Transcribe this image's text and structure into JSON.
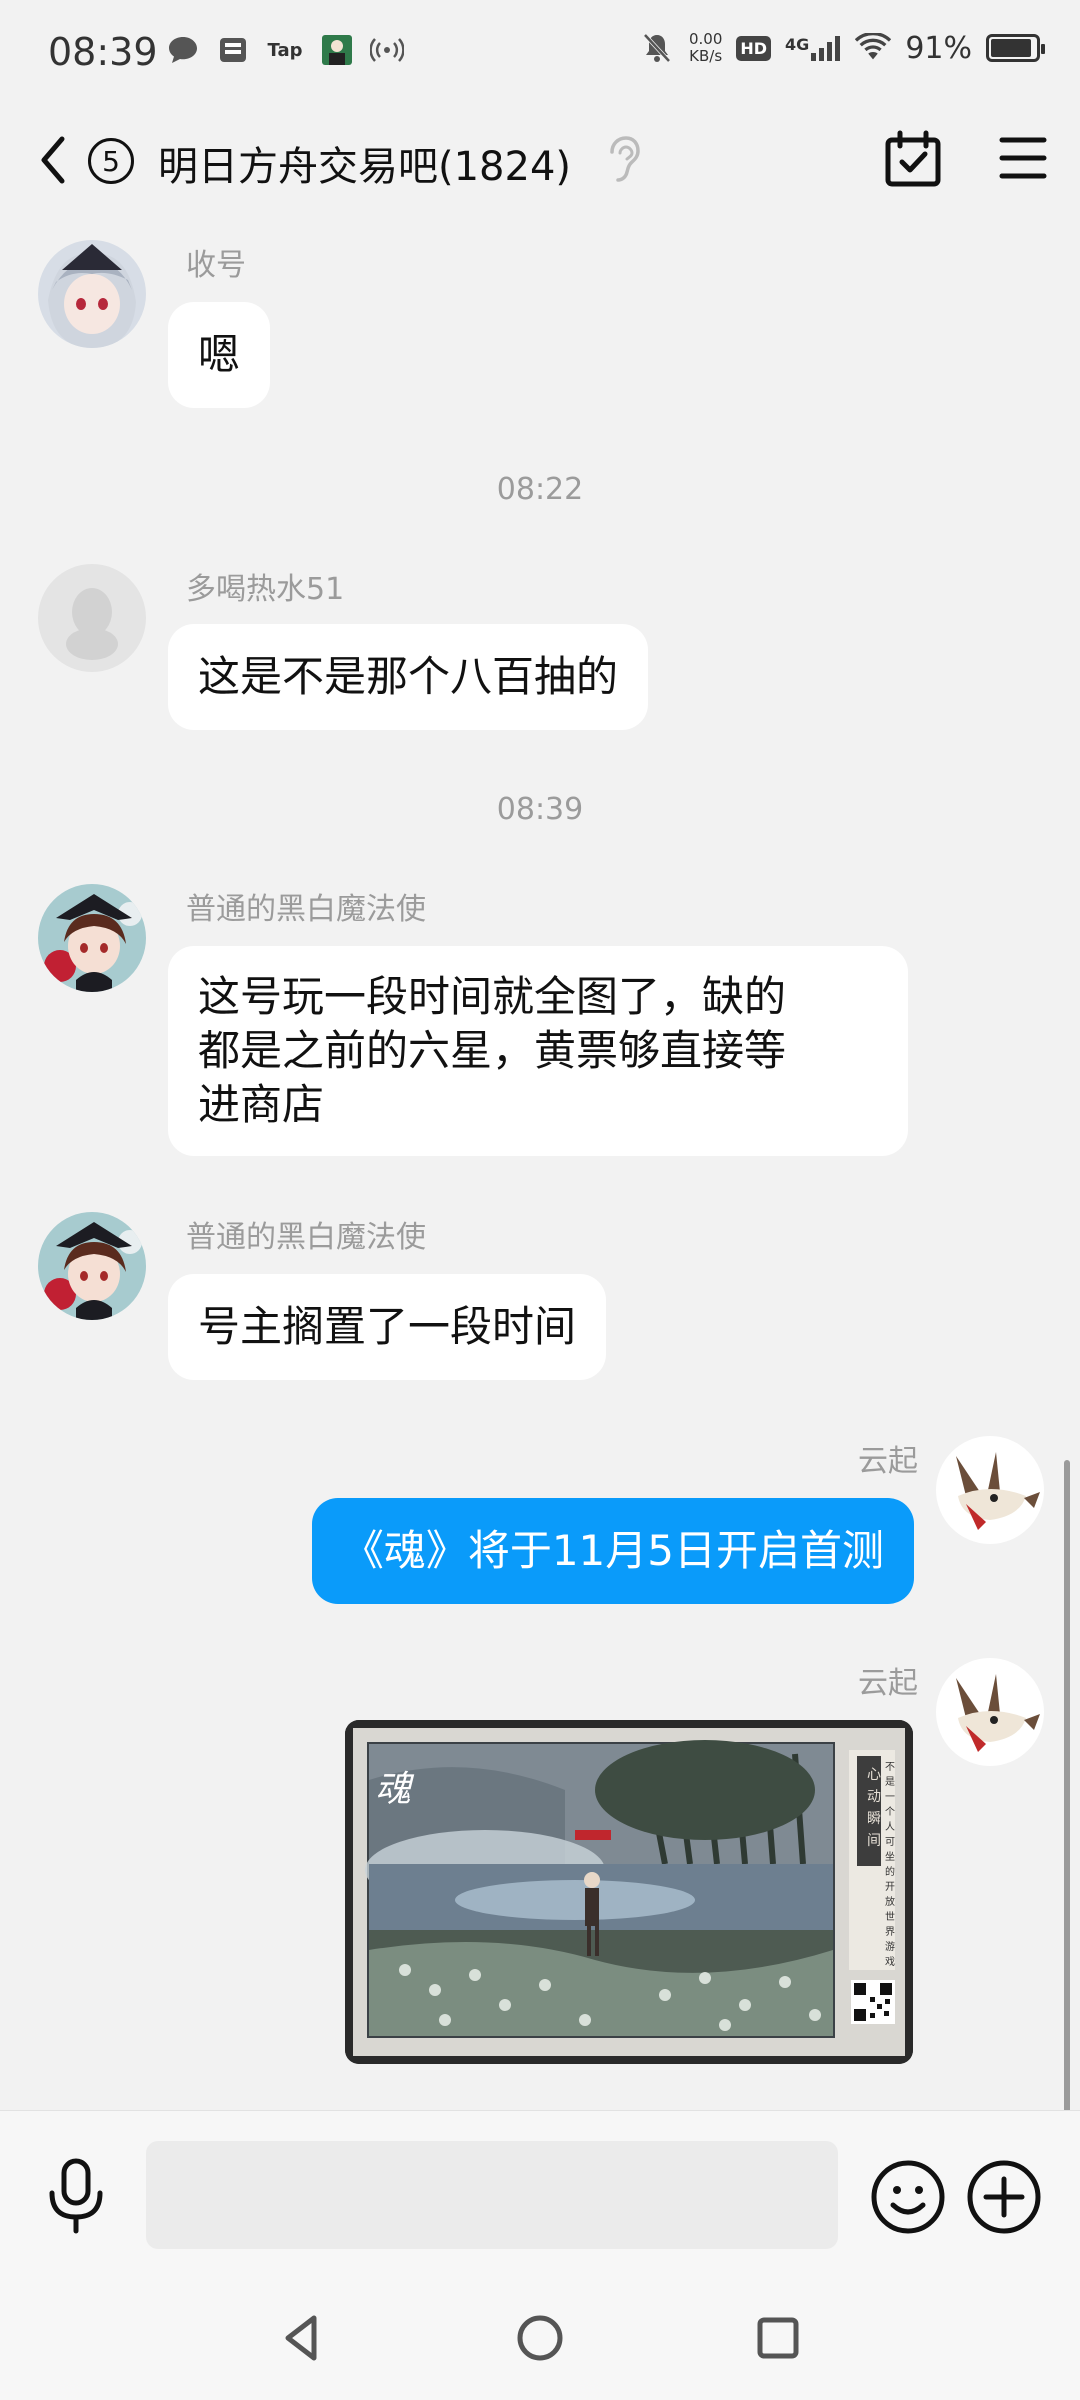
{
  "status_bar": {
    "time": "08:39",
    "tap_label": "Tap",
    "net_speed_value": "0.00",
    "net_speed_unit": "KB/s",
    "hd_label": "HD",
    "network_label": "4G",
    "battery": "91%",
    "battery_level": 0.91
  },
  "header": {
    "unread_count": "5",
    "title": "明日方舟交易吧(1824)"
  },
  "messages": [
    {
      "sender": "收号",
      "text": "嗯"
    },
    {
      "timestamp": "08:22"
    },
    {
      "sender": "多喝热水51",
      "text": "这是不是那个八百抽的"
    },
    {
      "timestamp": "08:39"
    },
    {
      "sender": "普通的黑白魔法使",
      "lines": [
        "这号玩一段时间就全图了，缺的",
        "都是之前的六星，黄票够直接等",
        "进商店"
      ]
    },
    {
      "sender": "普通的黑白魔法使",
      "text": "号主搁置了一段时间"
    },
    {
      "sender": "云起",
      "text": "《魂》将于11月5日开启首测",
      "self": true
    },
    {
      "sender": "云起",
      "self": true,
      "image": "game-promo-image"
    }
  ],
  "image_msg": {
    "logo_text": "魂",
    "sign_text": "心动瞬间",
    "vertical_text": "不是一个人可坐的开放世界游戏"
  },
  "input": {
    "placeholder": ""
  },
  "colors": {
    "self_bubble": "#0a9bfa",
    "background": "#f2f2f2",
    "bubble": "#ffffff"
  }
}
